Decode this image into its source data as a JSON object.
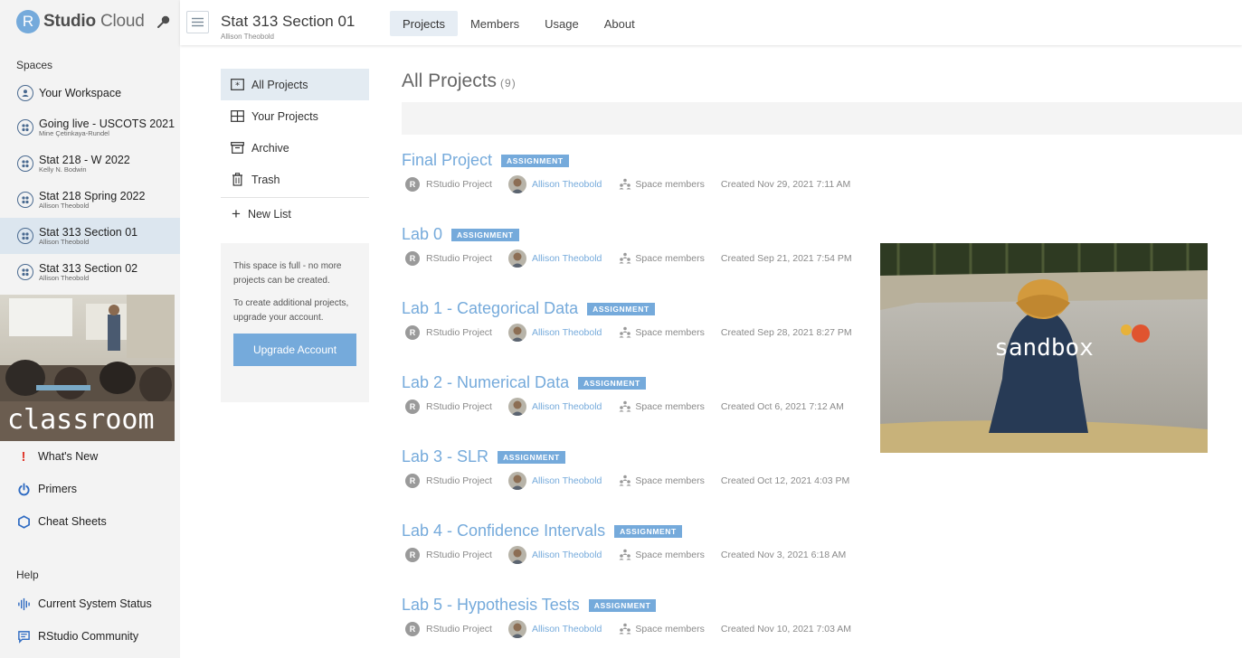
{
  "app": {
    "brand_r": "R",
    "brand_strong": "Studio",
    "brand_light": " Cloud"
  },
  "sidebar": {
    "spaces_heading": "Spaces",
    "workspace_label": "Your Workspace",
    "spaces": [
      {
        "name": "Going live - USCOTS 2021",
        "owner": "Mine Çetinkaya-Rundel",
        "active": false
      },
      {
        "name": "Stat 218 - W 2022",
        "owner": "Kelly N. Bodwin",
        "active": false
      },
      {
        "name": "Stat 218 Spring 2022",
        "owner": "Allison Theobold",
        "active": false
      },
      {
        "name": "Stat 313 Section 01",
        "owner": "Allison Theobold",
        "active": true
      },
      {
        "name": "Stat 313 Section 02",
        "owner": "Allison Theobold",
        "active": false
      }
    ],
    "classroom_caption": "classroom",
    "links": [
      {
        "label": "What's New",
        "icon": "exclamation-icon"
      },
      {
        "label": "Primers",
        "icon": "power-icon"
      },
      {
        "label": "Cheat Sheets",
        "icon": "hexagon-icon"
      }
    ],
    "help_heading": "Help",
    "help_links": [
      {
        "label": "Current System Status",
        "icon": "pulse-icon"
      },
      {
        "label": "RStudio Community",
        "icon": "chat-icon"
      }
    ]
  },
  "header": {
    "space_title": "Stat 313 Section 01",
    "space_owner": "Allison Theobold",
    "tabs": [
      {
        "label": "Projects",
        "active": true
      },
      {
        "label": "Members",
        "active": false
      },
      {
        "label": "Usage",
        "active": false
      },
      {
        "label": "About",
        "active": false
      }
    ]
  },
  "filters": {
    "items": [
      {
        "label": "All Projects",
        "icon": "all-projects-icon",
        "active": true
      },
      {
        "label": "Your Projects",
        "icon": "your-projects-icon",
        "active": false
      },
      {
        "label": "Archive",
        "icon": "archive-icon",
        "active": false
      },
      {
        "label": "Trash",
        "icon": "trash-icon",
        "active": false
      }
    ],
    "new_list_label": "New List"
  },
  "notice": {
    "full_text": "This space is full - no more projects can be created.",
    "upgrade_text": "To create additional projects, upgrade your account.",
    "button_label": "Upgrade Account"
  },
  "main": {
    "title": "All Projects",
    "count": "(9)",
    "sandbox_caption": "sandbox",
    "projects": [
      {
        "name": "Final Project",
        "badge": "ASSIGNMENT",
        "type": "RStudio Project",
        "owner": "Allison Theobold",
        "access": "Space members",
        "created": "Created Nov 29, 2021 7:11 AM"
      },
      {
        "name": "Lab 0",
        "badge": "ASSIGNMENT",
        "type": "RStudio Project",
        "owner": "Allison Theobold",
        "access": "Space members",
        "created": "Created Sep 21, 2021 7:54 PM"
      },
      {
        "name": "Lab 1 - Categorical Data",
        "badge": "ASSIGNMENT",
        "type": "RStudio Project",
        "owner": "Allison Theobold",
        "access": "Space members",
        "created": "Created Sep 28, 2021 8:27 PM"
      },
      {
        "name": "Lab 2 - Numerical Data",
        "badge": "ASSIGNMENT",
        "type": "RStudio Project",
        "owner": "Allison Theobold",
        "access": "Space members",
        "created": "Created Oct 6, 2021 7:12 AM"
      },
      {
        "name": "Lab 3 - SLR",
        "badge": "ASSIGNMENT",
        "type": "RStudio Project",
        "owner": "Allison Theobold",
        "access": "Space members",
        "created": "Created Oct 12, 2021 4:03 PM"
      },
      {
        "name": "Lab 4 - Confidence Intervals",
        "badge": "ASSIGNMENT",
        "type": "RStudio Project",
        "owner": "Allison Theobold",
        "access": "Space members",
        "created": "Created Nov 3, 2021 6:18 AM"
      },
      {
        "name": "Lab 5 - Hypothesis Tests",
        "badge": "ASSIGNMENT",
        "type": "RStudio Project",
        "owner": "Allison Theobold",
        "access": "Space members",
        "created": "Created Nov 10, 2021 7:03 AM"
      }
    ]
  },
  "colors": {
    "accent": "#75aadb",
    "active_bg": "#dce6ef",
    "sidebar_bg": "#f3f3f3"
  }
}
